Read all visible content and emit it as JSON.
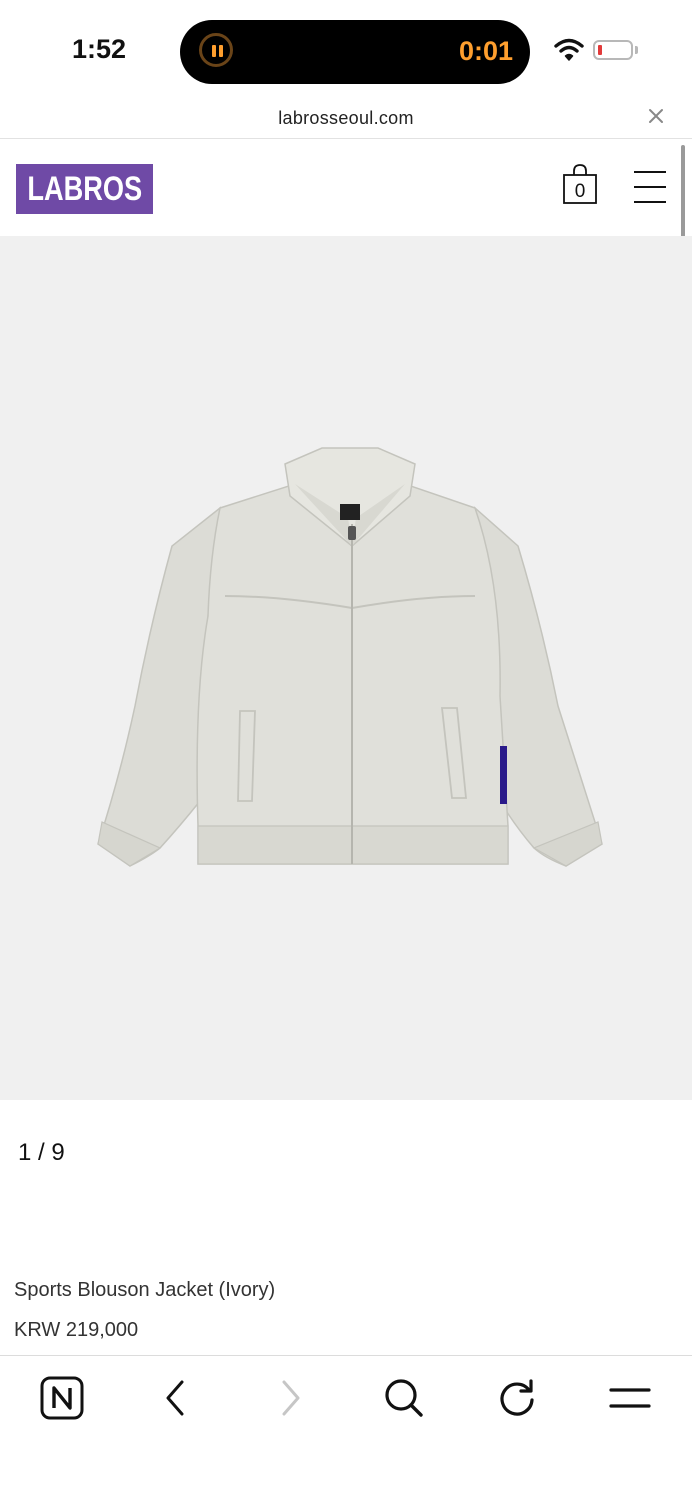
{
  "status_bar": {
    "time": "1:52",
    "timer": "0:01",
    "icons": [
      "pause-icon",
      "wifi-icon",
      "battery-low-icon"
    ]
  },
  "browser": {
    "url": "labrosseoul.com",
    "close_icon": "close-icon"
  },
  "site": {
    "logo_text": "LABROS",
    "cart_count": "0",
    "brand_color": "#6f4aa6",
    "icons": [
      "shopping-bag-icon",
      "hamburger-menu-icon"
    ]
  },
  "product": {
    "image_counter": "1 / 9",
    "name": "Sports Blouson Jacket (Ivory)",
    "price": "KRW 219,000",
    "image_background": "#f0f0f0",
    "jacket_color": "#dcdcd6"
  },
  "toolbar": {
    "items": [
      "naver-home-icon",
      "back-arrow-icon",
      "forward-arrow-icon",
      "search-icon",
      "reload-icon",
      "menu-icon"
    ]
  }
}
